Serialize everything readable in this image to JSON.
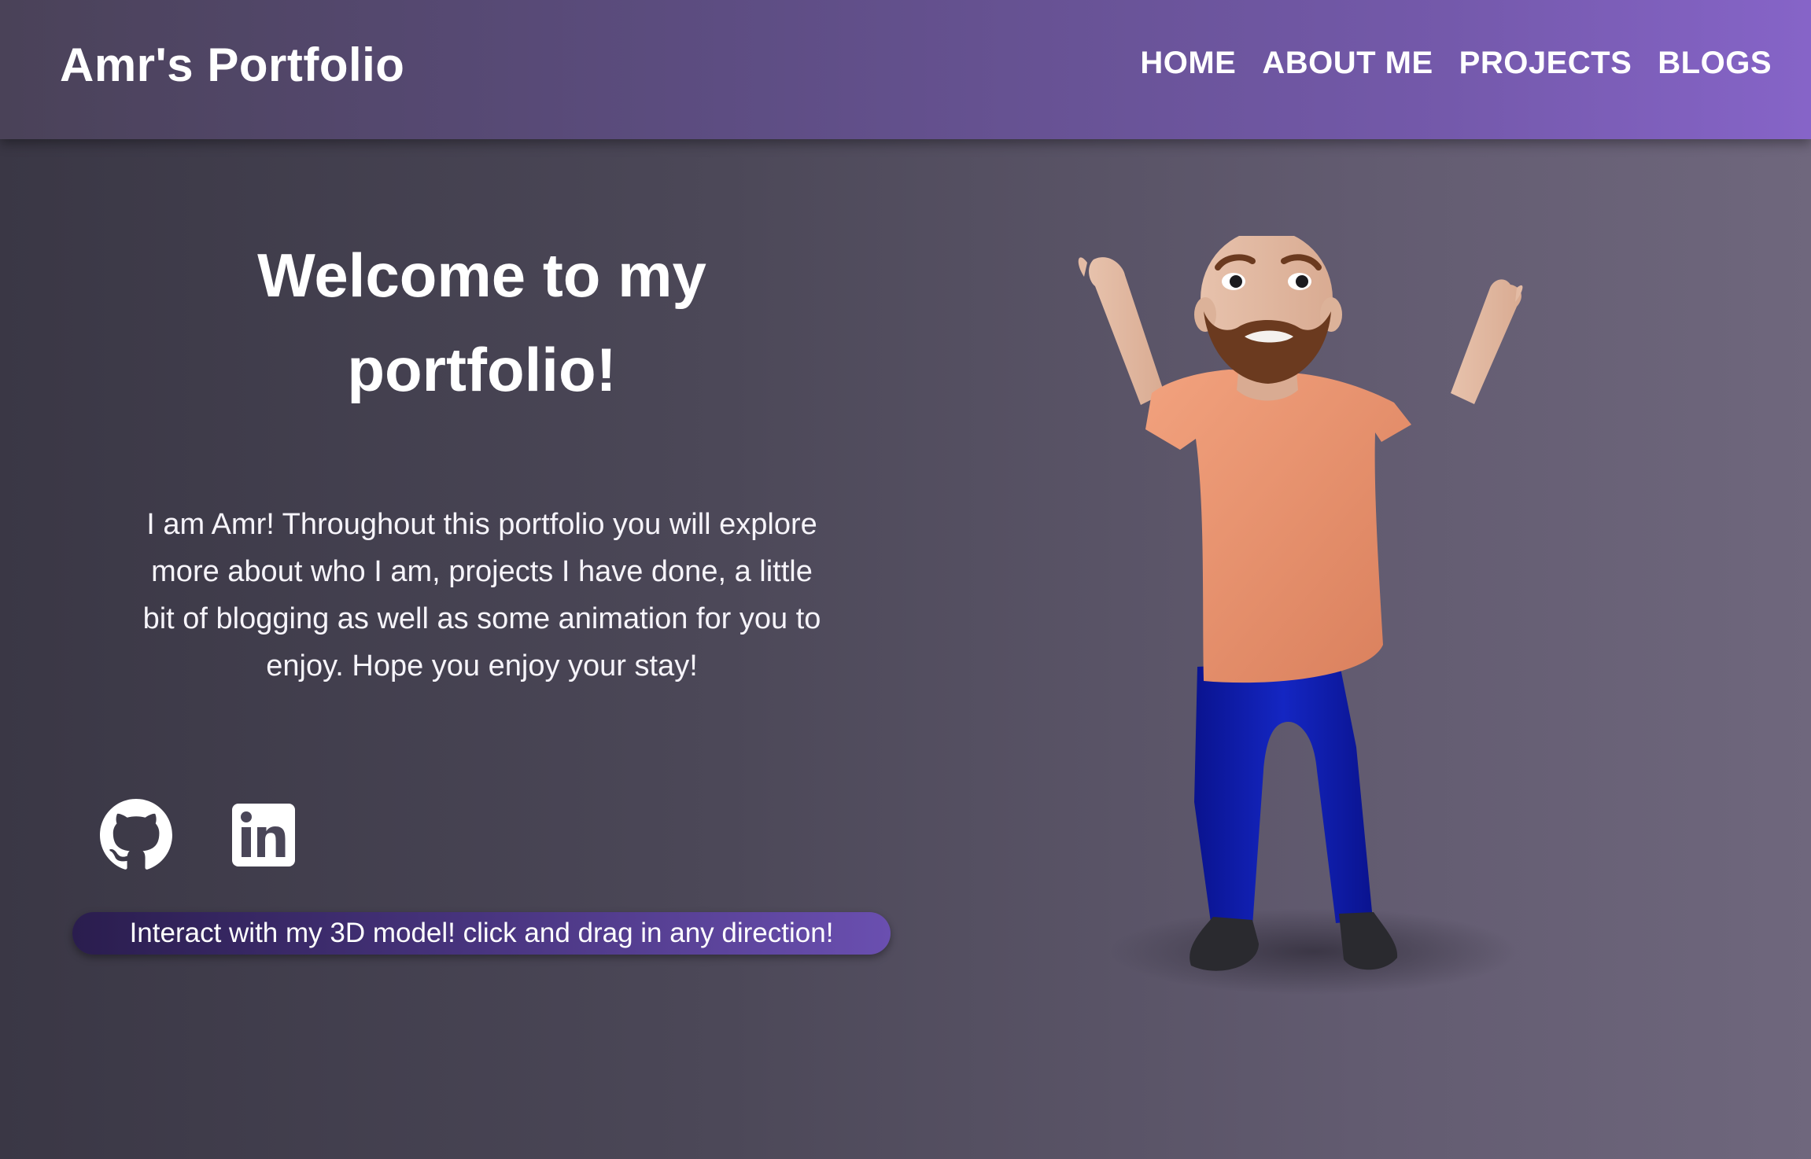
{
  "navbar": {
    "brand": "Amr's Portfolio",
    "links": [
      "HOME",
      "ABOUT ME",
      "PROJECTS",
      "BLOGS"
    ]
  },
  "hero": {
    "title": "Welcome to my portfolio!",
    "text": "I am Amr! Throughout this portfolio you will explore more about who I am, projects I have done, a little bit of blogging as well as some animation for you to enjoy. Hope you enjoy your stay!"
  },
  "social": {
    "icons": [
      "github-icon",
      "linkedin-icon"
    ]
  },
  "hint": {
    "text": "Interact with my 3D model! click and drag in any direction!"
  },
  "colors": {
    "nav_start": "#4a4258",
    "nav_end": "#8664c8",
    "background_start": "#3a3745",
    "background_end": "#6f677d",
    "shirt": "#e8906a",
    "pants": "#0d1aa8"
  }
}
